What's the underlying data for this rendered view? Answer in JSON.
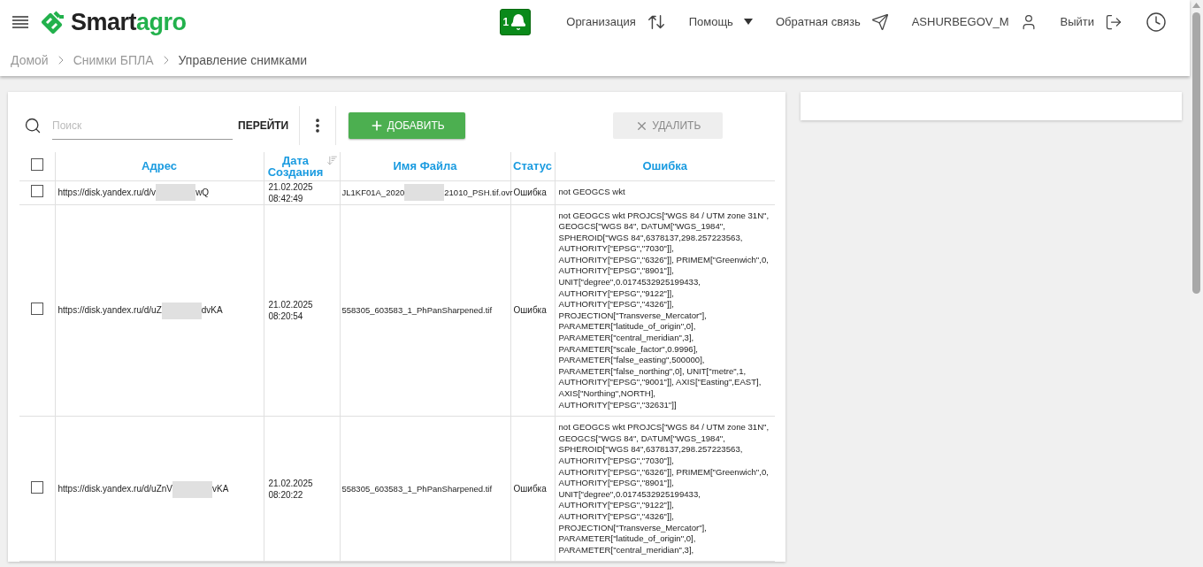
{
  "header": {
    "logo": {
      "part1": "Smart",
      "part2": "agro"
    },
    "notifications": {
      "count": "1"
    },
    "nav": [
      {
        "kind": "swap",
        "label": "Организация"
      },
      {
        "kind": "dropdown",
        "label": "Помощь"
      },
      {
        "kind": "send",
        "label": "Обратная связь"
      },
      {
        "kind": "user",
        "label": "ASHURBEGOV_M"
      },
      {
        "kind": "logout",
        "label": "Выйти"
      },
      {
        "kind": "history"
      }
    ]
  },
  "breadcrumbs": [
    {
      "label": "Домой"
    },
    {
      "label": "Снимки БПЛА"
    },
    {
      "label": "Управление снимками"
    }
  ],
  "toolbar": {
    "search": {
      "placeholder": "Поиск"
    },
    "go_button": "ПЕРЕЙТИ",
    "add_button": {
      "label": "ДОБАВИТЬ"
    },
    "delete_button": {
      "label": "УДАЛИТЬ",
      "disabled": true
    }
  },
  "table": {
    "select_all": {
      "checked": false
    },
    "columns": [
      {
        "label": "Адрес",
        "sorted": false
      },
      {
        "label": "Дата Создания",
        "sorted": true
      },
      {
        "label": "Имя Файла",
        "sorted": false
      },
      {
        "label": "Статус",
        "sorted": false
      },
      {
        "label": "Ошибка",
        "sorted": false
      }
    ],
    "rows": [
      {
        "checked": false,
        "address": {
          "text": "https://disk.yandex.ru/d/v",
          "redacted": true,
          "tail": "wQ"
        },
        "date": "21.02.2025",
        "time": "08:42:49",
        "file": {
          "text": "JL1KF01A_2020",
          "redacted": true,
          "tail": "21010_PSH.tif.ovr"
        },
        "status": "Ошибка",
        "error": "not GEOGCS wkt"
      },
      {
        "checked": false,
        "address": {
          "text": "https://disk.yandex.ru/d/uZ",
          "redacted": true,
          "tail": "dvKA"
        },
        "date": "21.02.2025",
        "time": "08:20:54",
        "file": {
          "text": "558305_603583_1_PhPanSharpened.tif",
          "redacted": false
        },
        "status": "Ошибка",
        "error": "not GEOGCS wkt PROJCS[\"WGS 84 / UTM zone 31N\", GEOGCS[\"WGS 84\", DATUM[\"WGS_1984\", SPHEROID[\"WGS 84\",6378137,298.257223563, AUTHORITY[\"EPSG\",\"7030\"]], AUTHORITY[\"EPSG\",\"6326\"]], PRIMEM[\"Greenwich\",0, AUTHORITY[\"EPSG\",\"8901\"]], UNIT[\"degree\",0.0174532925199433, AUTHORITY[\"EPSG\",\"9122\"]], AUTHORITY[\"EPSG\",\"4326\"]], PROJECTION[\"Transverse_Mercator\"], PARAMETER[\"latitude_of_origin\",0], PARAMETER[\"central_meridian\",3], PARAMETER[\"scale_factor\",0.9996], PARAMETER[\"false_easting\",500000], PARAMETER[\"false_northing\",0], UNIT[\"metre\",1, AUTHORITY[\"EPSG\",\"9001\"]], AXIS[\"Easting\",EAST], AXIS[\"Northing\",NORTH], AUTHORITY[\"EPSG\",\"32631\"]]"
      },
      {
        "checked": false,
        "address": {
          "text": "https://disk.yandex.ru/d/uZnV",
          "redacted": true,
          "tail": "vKA"
        },
        "date": "21.02.2025",
        "time": "08:20:22",
        "file": {
          "text": "558305_603583_1_PhPanSharpened.tif",
          "redacted": false
        },
        "status": "Ошибка",
        "error": "not GEOGCS wkt PROJCS[\"WGS 84 / UTM zone 31N\", GEOGCS[\"WGS 84\", DATUM[\"WGS_1984\", SPHEROID[\"WGS 84\",6378137,298.257223563, AUTHORITY[\"EPSG\",\"7030\"]], AUTHORITY[\"EPSG\",\"6326\"]], PRIMEM[\"Greenwich\",0, AUTHORITY[\"EPSG\",\"8901\"]], UNIT[\"degree\",0.0174532925199433, AUTHORITY[\"EPSG\",\"9122\"]], AUTHORITY[\"EPSG\",\"4326\"]], PROJECTION[\"Transverse_Mercator\"], PARAMETER[\"latitude_of_origin\",0], PARAMETER[\"central_meridian\",3],"
      }
    ]
  }
}
